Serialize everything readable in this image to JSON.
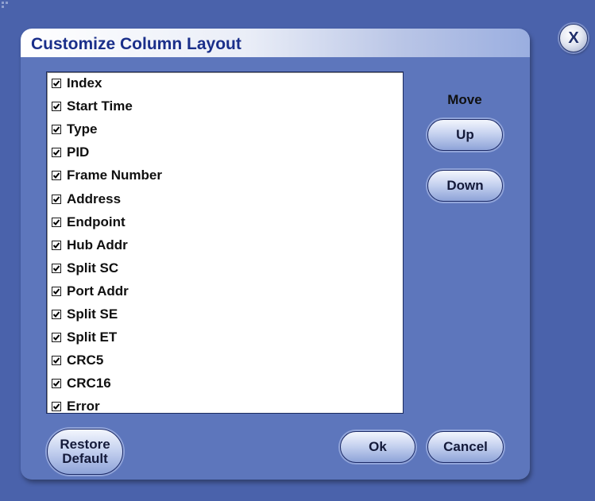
{
  "dialog": {
    "title": "Customize Column Layout",
    "close_label": "X"
  },
  "columns": [
    {
      "label": "Index",
      "checked": true
    },
    {
      "label": "Start Time",
      "checked": true
    },
    {
      "label": "Type",
      "checked": true
    },
    {
      "label": "PID",
      "checked": true
    },
    {
      "label": "Frame Number",
      "checked": true
    },
    {
      "label": "Address",
      "checked": true
    },
    {
      "label": "Endpoint",
      "checked": true
    },
    {
      "label": "Hub Addr",
      "checked": true
    },
    {
      "label": "Split SC",
      "checked": true
    },
    {
      "label": "Port Addr",
      "checked": true
    },
    {
      "label": "Split SE",
      "checked": true
    },
    {
      "label": "Split ET",
      "checked": true
    },
    {
      "label": "CRC5",
      "checked": true
    },
    {
      "label": "CRC16",
      "checked": true
    },
    {
      "label": "Error",
      "checked": true
    }
  ],
  "move": {
    "label": "Move",
    "up_label": "Up",
    "down_label": "Down"
  },
  "buttons": {
    "restore_line1": "Restore",
    "restore_line2": "Default",
    "ok_label": "Ok",
    "cancel_label": "Cancel"
  },
  "colors": {
    "background": "#4a62ab",
    "dialog": "#5d76bc",
    "title_text": "#1a2f8a"
  }
}
